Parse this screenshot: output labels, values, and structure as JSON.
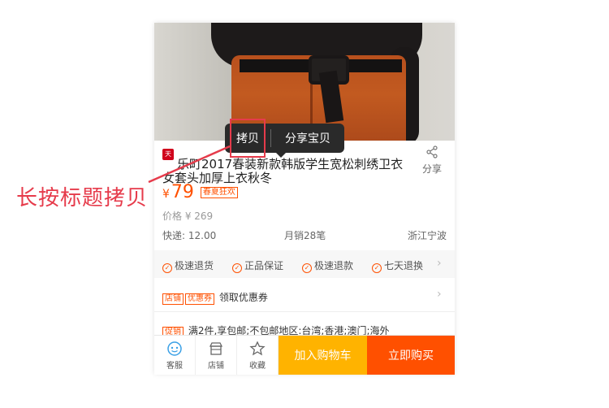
{
  "popup": {
    "copy_label": "拷贝",
    "share_label": "分享宝贝"
  },
  "annotation": {
    "text": "长按标题拷贝"
  },
  "product": {
    "badge": "天猫",
    "title": "乐町2017春装新款韩版学生宽松刺绣卫衣女套头加厚上衣秋冬",
    "share_label": "分享",
    "currency": "¥",
    "price": "79",
    "promo_tag": "春夏狂欢",
    "original_price": "价格 ¥ 269",
    "shipping": "快递: 12.00",
    "monthly_sales": "月销28笔",
    "location": "浙江宁波"
  },
  "guarantees": [
    "极速退货",
    "正品保证",
    "极速退款",
    "七天退换"
  ],
  "coupon": {
    "tag_shop": "店铺",
    "tag_coupon": "优惠券",
    "label": "领取优惠券"
  },
  "promotion": {
    "tag": "促销",
    "text": "满2件,享包邮;不包邮地区:台湾;香港;澳门;海外"
  },
  "bottom_bar": {
    "service": "客服",
    "shop": "店铺",
    "favorite": "收藏",
    "add_to_cart": "加入购物车",
    "buy_now": "立即购买"
  },
  "colors": {
    "accent": "#ff5000",
    "cart": "#ffb300",
    "annotation": "#e63b4b"
  }
}
